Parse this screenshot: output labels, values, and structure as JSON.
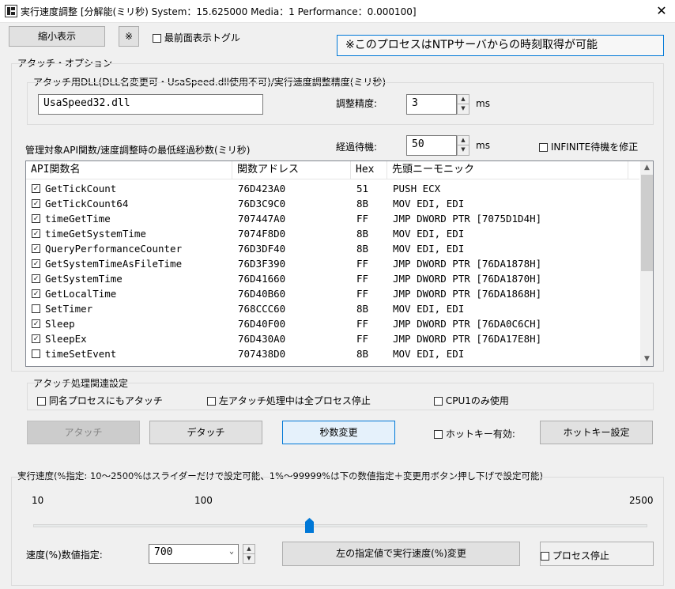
{
  "window": {
    "title": "実行速度調整 [分解能(ミリ秒)  System：15.625000  Media：1  Performance：0.000100]",
    "close_glyph": "✕"
  },
  "top": {
    "shrink_button": "縮小表示",
    "mark_button": "※",
    "topmost_toggle": "最前面表示トグル",
    "topmost_checked": false,
    "ntp_notice": "※このプロセスはNTPサーバからの時刻取得が可能"
  },
  "attach_options": {
    "group_label": "アタッチ・オプション",
    "dll_group_label": "アタッチ用DLL(DLL名変更可・UsaSpeed.dll使用不可)/実行速度調整精度(ミリ秒)",
    "dll_name": "UsaSpeed32.dll",
    "precision_label": "調整精度:",
    "precision_value": "3",
    "precision_unit": "ms",
    "managed_label": "管理対象API関数/速度調整時の最低経過秒数(ミリ秒)",
    "wait_label": "経過待機:",
    "wait_value": "50",
    "wait_unit": "ms",
    "infinite_label": "INFINITE待機を修正",
    "infinite_checked": false
  },
  "api_table": {
    "columns": [
      "API関数名",
      "関数アドレス",
      "Hex",
      "先頭ニーモニック"
    ],
    "rows": [
      {
        "checked": true,
        "name": "GetTickCount",
        "address": "76D423A0",
        "hex": "51",
        "mnemonic": "PUSH ECX"
      },
      {
        "checked": true,
        "name": "GetTickCount64",
        "address": "76D3C9C0",
        "hex": "8B",
        "mnemonic": "MOV EDI, EDI"
      },
      {
        "checked": true,
        "name": "timeGetTime",
        "address": "707447A0",
        "hex": "FF",
        "mnemonic": "JMP DWORD PTR [7075D1D4H]"
      },
      {
        "checked": true,
        "name": "timeGetSystemTime",
        "address": "7074F8D0",
        "hex": "8B",
        "mnemonic": "MOV EDI, EDI"
      },
      {
        "checked": true,
        "name": "QueryPerformanceCounter",
        "address": "76D3DF40",
        "hex": "8B",
        "mnemonic": "MOV EDI, EDI"
      },
      {
        "checked": true,
        "name": "GetSystemTimeAsFileTime",
        "address": "76D3F390",
        "hex": "FF",
        "mnemonic": "JMP DWORD PTR [76DA1878H]"
      },
      {
        "checked": true,
        "name": "GetSystemTime",
        "address": "76D41660",
        "hex": "FF",
        "mnemonic": "JMP DWORD PTR [76DA1870H]"
      },
      {
        "checked": true,
        "name": "GetLocalTime",
        "address": "76D40B60",
        "hex": "FF",
        "mnemonic": "JMP DWORD PTR [76DA1868H]"
      },
      {
        "checked": false,
        "name": "SetTimer",
        "address": "768CCC60",
        "hex": "8B",
        "mnemonic": "MOV EDI, EDI"
      },
      {
        "checked": true,
        "name": "Sleep",
        "address": "76D40F00",
        "hex": "FF",
        "mnemonic": "JMP DWORD PTR [76DA0C6CH]"
      },
      {
        "checked": true,
        "name": "SleepEx",
        "address": "76D430A0",
        "hex": "FF",
        "mnemonic": "JMP DWORD PTR [76DA17E8H]"
      },
      {
        "checked": false,
        "name": "timeSetEvent",
        "address": "707438D0",
        "hex": "8B",
        "mnemonic": "MOV EDI, EDI"
      }
    ]
  },
  "attach_processing": {
    "group_label": "アタッチ処理関連設定",
    "same_name_label": "同名プロセスにもアタッチ",
    "same_name_checked": false,
    "stop_all_label": "左アタッチ処理中は全プロセス停止",
    "stop_all_checked": false,
    "cpu1_label": "CPU1のみ使用",
    "cpu1_checked": false
  },
  "actions": {
    "attach": "アタッチ",
    "detach": "デタッチ",
    "change_seconds": "秒数変更",
    "hotkey_enable": "ホットキー有効:",
    "hotkey_checked": false,
    "hotkey_settings": "ホットキー設定"
  },
  "speed": {
    "group_label": "実行速度(%指定: 10～2500%はスライダーだけで設定可能、1%～99999%は下の数値指定＋変更用ボタン押し下げで設定可能)",
    "tick_min": "10",
    "tick_mid": "100",
    "tick_max": "2500",
    "slider_fraction": 0.45,
    "value_label": "速度(%)数値指定:",
    "value": "700",
    "apply_button": "左の指定値で実行速度(%)変更",
    "stop_process_label": "プロセス停止",
    "stop_process_checked": false
  }
}
